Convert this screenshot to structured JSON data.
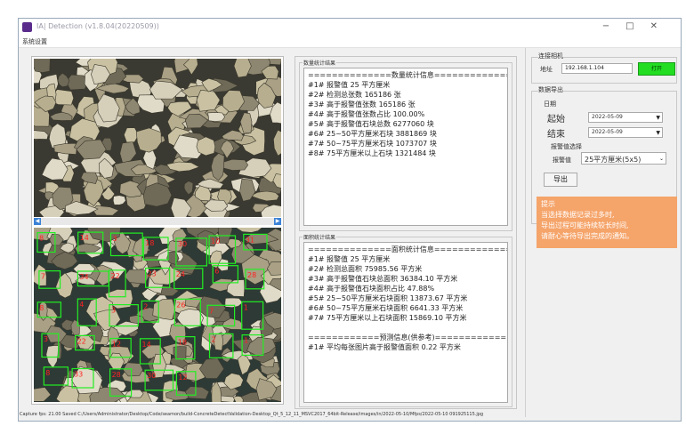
{
  "window": {
    "title": "IA| Detection (v1.8.04(20220509))"
  },
  "menu": {
    "system_settings": "系统设置"
  },
  "quantity_stats": {
    "group_label": "数量统计结果",
    "lines": [
      "==============数量统计信息==============",
      "#1# 报警值 25 平方厘米",
      "#2# 检测总张数 165186 张",
      "#3# 高于报警值张数 165186 张",
      "#4# 高于报警值张数占比 100.00%",
      "#5# 高于报警值石块总数 6277060 块",
      "#6# 25~50平方厘米石块 3881869 块",
      "#7# 50~75平方厘米石块 1073707 块",
      "#8# 75平方厘米以上石块 1321484 块"
    ]
  },
  "area_stats": {
    "group_label": "面积统计结果",
    "lines": [
      "==============面积统计信息==============",
      "#1# 报警值 25 平方厘米",
      "#2# 检测总面积 75985.56 平方米",
      "#3# 高于报警值石块总面积 36384.10 平方米",
      "#4# 高于报警值石块面积占比 47.88%",
      "#5# 25~50平方厘米石块面积 13873.67 平方米",
      "#6# 50~75平方厘米石块面积 6641.33 平方米",
      "#7# 75平方厘米以上石块面积 15869.10 平方米",
      "",
      "============预测信息(供参考)============",
      "#1# 平均每张图片高于报警值面积 0.22 平方米"
    ]
  },
  "connection": {
    "group_label": "连接相机",
    "address_label": "地址",
    "address_value": "192.168.1.104",
    "connect_label": "打开"
  },
  "export": {
    "group_label": "数据导出",
    "date_label": "日期",
    "start_label": "起始",
    "start_value": "2022-05-09",
    "end_label": "结束",
    "end_value": "2022-05-09",
    "alarm_group_label": "报警值选择",
    "alarm_label": "报警值",
    "alarm_value": "25平方厘米(5x5)",
    "export_button": "导出"
  },
  "tip": {
    "title": "提示",
    "lines": [
      "当选择数据记录过多时,",
      "导出过程可能持续较长时间,",
      "请耐心等待导出完成的通知。"
    ]
  },
  "status_bar": {
    "text": "Capture fps: 21.00 Saved C:/Users/Administrator/Desktop/Code/seamon/build-ConcreteDetectValidation-Desktop_Qt_5_12_11_MSVC2017_64bit-Release/images/in/2022-05-10/Mfps/2022-05-10 091925115.jpg"
  },
  "detections": {
    "labels": [
      "8",
      "14",
      "3",
      "18",
      "30",
      "10",
      "31",
      "7",
      "34",
      "22",
      "23",
      "24",
      "6",
      "28",
      "8",
      "4",
      "3",
      "2",
      "26",
      "7",
      "1",
      "3",
      "22",
      "12",
      "14",
      "18",
      "2",
      "1",
      "8",
      "33",
      "28",
      "30",
      "12"
    ],
    "box_color": "#22ee22"
  }
}
